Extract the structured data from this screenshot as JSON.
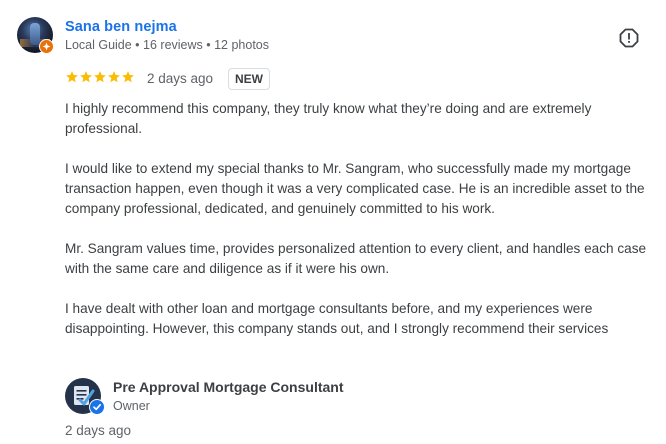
{
  "review": {
    "reviewer_name": "Sana ben nejma",
    "reviewer_meta": "Local Guide • 16 reviews • 12 photos",
    "rating": 5,
    "rating_max": 5,
    "time": "2 days ago",
    "badge": "NEW",
    "paragraphs": [
      "I highly recommend this company, they truly know what they’re doing and are extremely professional.",
      "I would like to extend my special thanks to Mr. Sangram, who successfully made my mortgage transaction happen, even though it was a very complicated case. He is an incredible asset to the company professional, dedicated, and genuinely committed to his work.",
      "Mr. Sangram values time, provides personalized attention to every client, and handles each case with the same care and diligence as if it were his own.",
      "I have dealt with other loan and mortgage consultants before, and my experiences were disappointing. However, this company stands out, and I strongly recommend their services"
    ]
  },
  "owner_response": {
    "name": "Pre Approval Mortgage Consultant",
    "role": "Owner",
    "time": "2 days ago"
  },
  "colors": {
    "star": "#fbbc04",
    "name_link": "#1a73e8",
    "local_guide_badge": "#e8710a",
    "verified_badge": "#1a73e8"
  },
  "icons": {
    "report": "report-icon",
    "local_guide": "local-guide-badge-icon",
    "verified": "verified-check-icon"
  }
}
